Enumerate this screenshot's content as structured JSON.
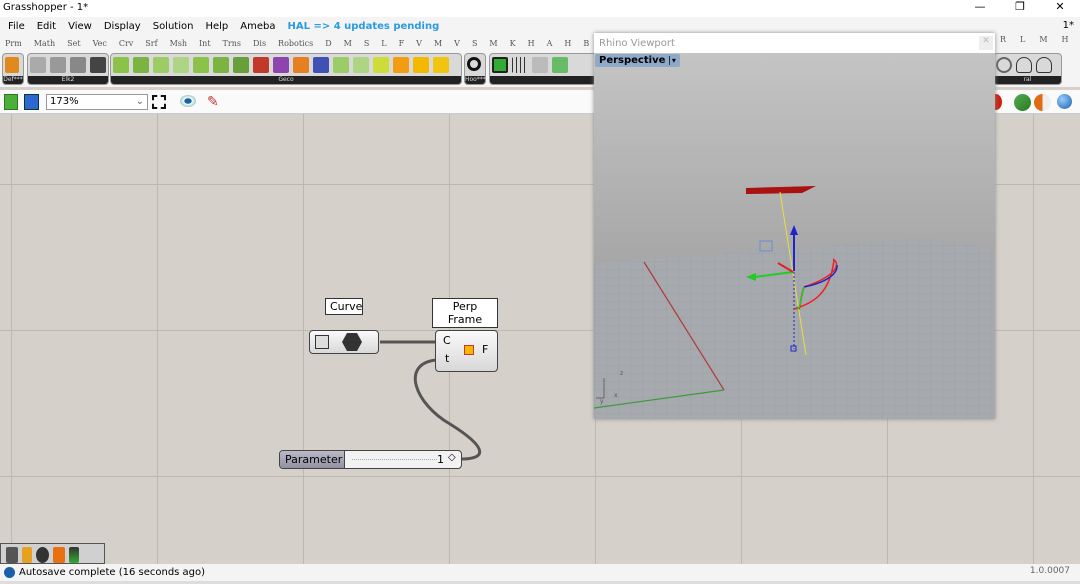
{
  "window": {
    "title": "Grasshopper - 1*",
    "doc_name": "1*",
    "controls": [
      "—",
      "❐",
      "✕"
    ]
  },
  "menu": [
    "File",
    "Edit",
    "View",
    "Display",
    "Solution",
    "Help",
    "Ameba"
  ],
  "menu_notice": "HAL => 4 updates pending",
  "tabs": [
    "Prm",
    "Math",
    "Set",
    "Vec",
    "Crv",
    "Srf",
    "Msh",
    "Int",
    "Trns",
    "Dis",
    "Robotics",
    "D",
    "M",
    "S",
    "L",
    "F",
    "V",
    "M",
    "V",
    "S",
    "M",
    "K",
    "H",
    "A",
    "H",
    "B"
  ],
  "tabs_right": [
    "R",
    "L",
    "M",
    "H"
  ],
  "ribbon_panels": [
    "Def***",
    "Elk2",
    "Geco",
    "Hoo***",
    "ral"
  ],
  "toolbar": {
    "zoom": "173%"
  },
  "canvas": {
    "curve_param": {
      "tooltip": "Curve"
    },
    "perp_frame": {
      "tooltip": "Perp Frame",
      "inputs": [
        "C",
        "t"
      ],
      "output": "F"
    },
    "slider": {
      "label": "Parameter",
      "value": "1",
      "fraction": 0.98
    }
  },
  "viewport": {
    "title": "Rhino Viewport",
    "view": "Perspective",
    "axes": [
      "z",
      "y",
      "x"
    ]
  },
  "status": {
    "message": "Autosave complete (16 seconds ago)",
    "version": "1.0.0007"
  },
  "colors": {
    "hal": "#2a9be0",
    "wire": "#555555",
    "viewport_label": "#8fa9c8"
  }
}
